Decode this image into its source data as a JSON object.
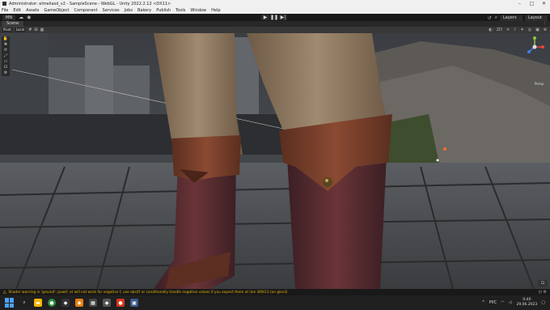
{
  "title": {
    "text": "Administrator: elmeliasd_v2 - SampleScene - WebGL - Unity 2022.2.12 <DX11>"
  },
  "menu": [
    "File",
    "Edit",
    "Assets",
    "GameObject",
    "Component",
    "Services",
    "Jobs",
    "Bakery",
    "Publish",
    "Tools",
    "Window",
    "Help"
  ],
  "toolbar": {
    "account": "MN",
    "layers": "Layers",
    "layout": "Layout"
  },
  "tabs": {
    "scene": "Scene",
    "menu_icon": "⋮"
  },
  "scene_toolbar": {
    "pivot": "Pivot",
    "local": "Local",
    "persp": "Persp"
  },
  "status": {
    "message": "Shader warning in 'ground': pow(f, e) will not work for negative f, use abs(f) or conditionally handle negative values if you expect them at line 369/13 (on gles3)"
  },
  "taskbar": {
    "lang": "РУС",
    "time": "0:40",
    "date": "29.06.2023"
  },
  "colors": {
    "warning": "#e6b400",
    "accent": "#4aa3ff"
  }
}
